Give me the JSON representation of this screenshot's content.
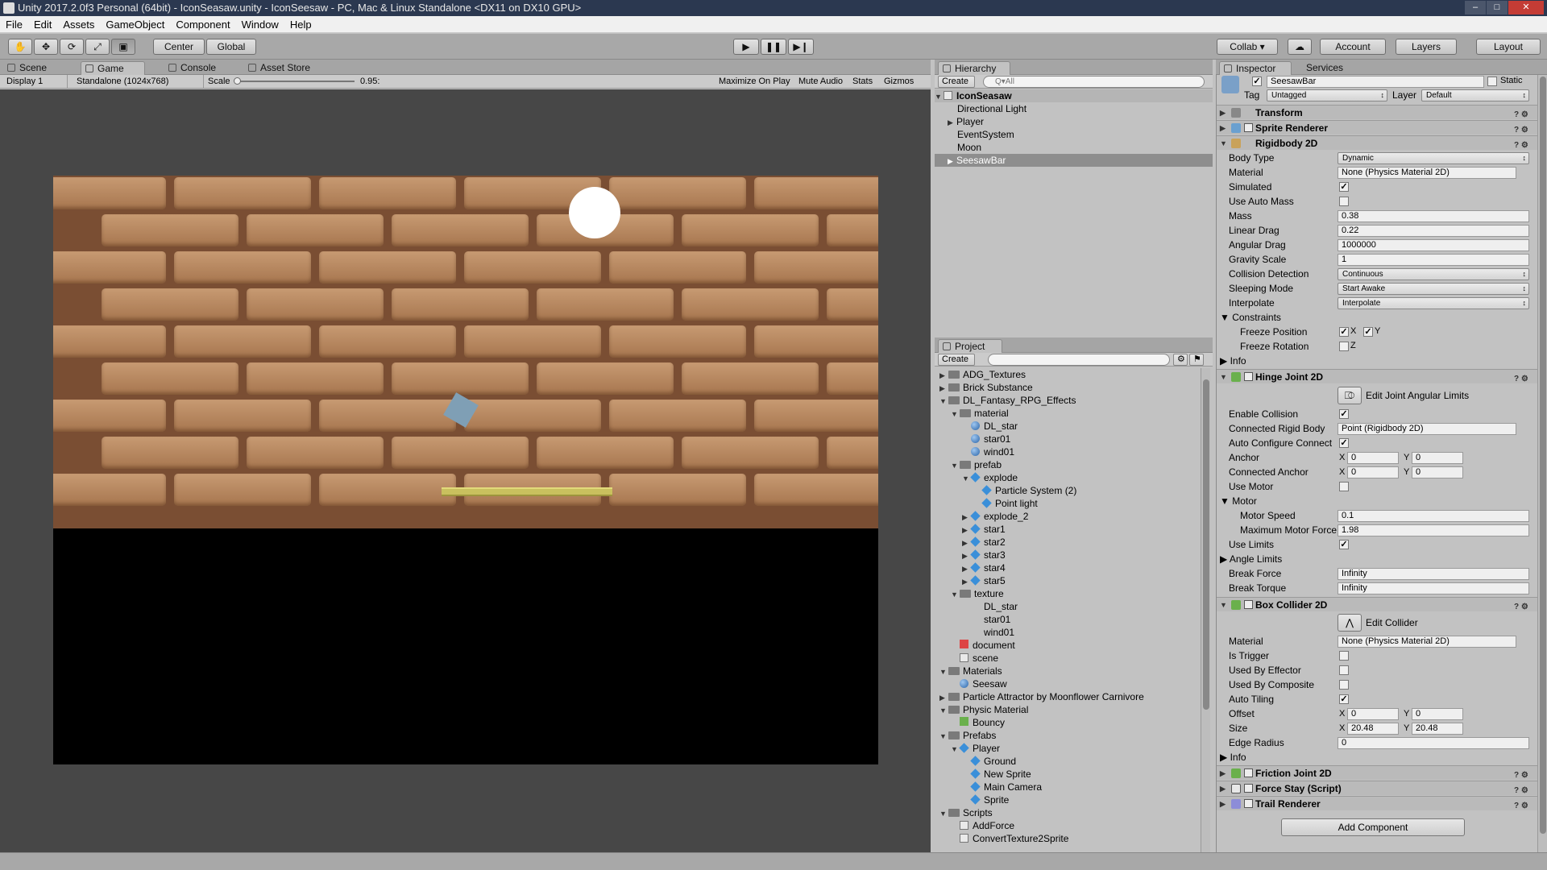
{
  "window": {
    "title": "Unity 2017.2.0f3 Personal (64bit) - IconSeasaw.unity - IconSeesaw - PC, Mac & Linux Standalone <DX11 on DX10 GPU>"
  },
  "menu": [
    "File",
    "Edit",
    "Assets",
    "GameObject",
    "Component",
    "Window",
    "Help"
  ],
  "toolbar": {
    "pivot": "Center",
    "space": "Global",
    "play": "▶",
    "pause": "❚❚",
    "step": "▶❙",
    "collab": "Collab ▾",
    "account": "Account",
    "layers": "Layers",
    "layout": "Layout"
  },
  "game_tabs": [
    "Scene",
    "Game",
    "Console",
    "Asset Store"
  ],
  "game_bar": {
    "display": "Display 1",
    "resolution": "Standalone (1024x768)",
    "scale_label": "Scale",
    "scale_value": "0.95:",
    "maximize": "Maximize On Play",
    "mute": "Mute Audio",
    "stats": "Stats",
    "gizmos": "Gizmos"
  },
  "hierarchy": {
    "title": "Hierarchy",
    "create": "Create",
    "search_placeholder": "Q▾All",
    "scene": "IconSeasaw",
    "items": [
      "Directional Light",
      "Player",
      "EventSystem",
      "Moon",
      "SeesawBar"
    ]
  },
  "project": {
    "title": "Project",
    "create": "Create",
    "rows": [
      {
        "label": "ADG_Textures"
      },
      {
        "label": "Brick Substance"
      },
      {
        "label": "DL_Fantasy_RPG_Effects"
      },
      {
        "label": "material"
      },
      {
        "label": "DL_star"
      },
      {
        "label": "star01"
      },
      {
        "label": "wind01"
      },
      {
        "label": "prefab"
      },
      {
        "label": "explode"
      },
      {
        "label": "Particle System (2)"
      },
      {
        "label": "Point light"
      },
      {
        "label": "explode_2"
      },
      {
        "label": "star1"
      },
      {
        "label": "star2"
      },
      {
        "label": "star3"
      },
      {
        "label": "star4"
      },
      {
        "label": "star5"
      },
      {
        "label": "texture"
      },
      {
        "label": "DL_star"
      },
      {
        "label": "star01"
      },
      {
        "label": "wind01"
      },
      {
        "label": "document"
      },
      {
        "label": "scene"
      },
      {
        "label": "Materials"
      },
      {
        "label": "Seesaw"
      },
      {
        "label": "Particle Attractor by Moonflower Carnivore"
      },
      {
        "label": "Physic Material"
      },
      {
        "label": "Bouncy"
      },
      {
        "label": "Prefabs"
      },
      {
        "label": "Player"
      },
      {
        "label": "Ground"
      },
      {
        "label": "New Sprite"
      },
      {
        "label": "Main Camera"
      },
      {
        "label": "Sprite"
      },
      {
        "label": "Scripts"
      },
      {
        "label": "AddForce"
      },
      {
        "label": "ConvertTexture2Sprite"
      }
    ]
  },
  "inspector": {
    "tabs": [
      "Inspector",
      "Services"
    ],
    "object_name": "SeesawBar",
    "static": "Static",
    "tag_label": "Tag",
    "tag": "Untagged",
    "layer_label": "Layer",
    "layer": "Default",
    "components": {
      "transform": "Transform",
      "sprite_renderer": "Sprite Renderer",
      "rigidbody": "Rigidbody 2D",
      "hinge": "Hinge Joint 2D",
      "box": "Box Collider 2D",
      "friction": "Friction Joint 2D",
      "force_stay": "Force Stay (Script)",
      "trail": "Trail Renderer"
    },
    "rb": {
      "body_type_l": "Body Type",
      "body_type": "Dynamic",
      "material_l": "Material",
      "material": "None (Physics Material 2D)",
      "simulated_l": "Simulated",
      "auto_mass_l": "Use Auto Mass",
      "mass_l": "Mass",
      "mass": "0.38",
      "linear_l": "Linear Drag",
      "linear": "0.22",
      "angular_l": "Angular Drag",
      "angular": "1000000",
      "gravity_l": "Gravity Scale",
      "gravity": "1",
      "collision_l": "Collision Detection",
      "collision": "Continuous",
      "sleeping_l": "Sleeping Mode",
      "sleeping": "Start Awake",
      "interp_l": "Interpolate",
      "interp": "Interpolate",
      "constraints_l": "Constraints",
      "freeze_pos_l": "Freeze Position",
      "freeze_rot_l": "Freeze Rotation",
      "x": "X",
      "y": "Y",
      "z": "Z",
      "info_l": "Info"
    },
    "hinge": {
      "edit_limits": "Edit Joint Angular Limits",
      "enable_collision_l": "Enable Collision",
      "connected_rb_l": "Connected Rigid Body",
      "connected_rb": "Point (Rigidbody 2D)",
      "auto_config_l": "Auto Configure Connect",
      "anchor_l": "Anchor",
      "anchor_x": "0",
      "anchor_y": "0",
      "conn_anchor_l": "Connected Anchor",
      "conn_anchor_x": "0",
      "conn_anchor_y": "0",
      "use_motor_l": "Use Motor",
      "motor_l": "Motor",
      "motor_speed_l": "Motor Speed",
      "motor_speed": "0.1",
      "max_force_l": "Maximum Motor Force",
      "max_force": "1.98",
      "use_limits_l": "Use Limits",
      "angle_limits_l": "Angle Limits",
      "break_force_l": "Break Force",
      "break_force": "Infinity",
      "break_torque_l": "Break Torque",
      "break_torque": "Infinity"
    },
    "box": {
      "edit_collider": "Edit Collider",
      "material_l": "Material",
      "material": "None (Physics Material 2D)",
      "trigger_l": "Is Trigger",
      "effector_l": "Used By Effector",
      "composite_l": "Used By Composite",
      "tiling_l": "Auto Tiling",
      "offset_l": "Offset",
      "offset_x": "0",
      "offset_y": "0",
      "size_l": "Size",
      "size_x": "20.48",
      "size_y": "20.48",
      "radius_l": "Edge Radius",
      "radius": "0",
      "info_l": "Info"
    },
    "add_component": "Add Component"
  }
}
